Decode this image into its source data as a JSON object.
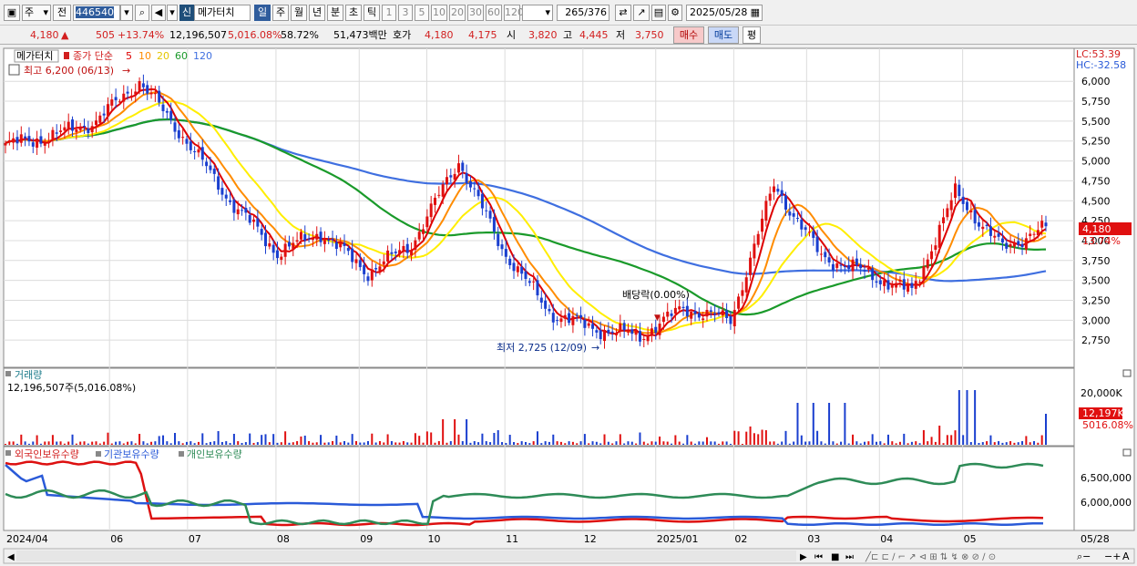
{
  "toolbar": {
    "market": "주",
    "prev_label": "전",
    "code": "446540",
    "new_badge": "신",
    "stock_name": "메가터치",
    "periods": [
      "일",
      "주",
      "월",
      "년",
      "분",
      "초",
      "틱"
    ],
    "intervals": [
      "1",
      "3",
      "5",
      "10",
      "20",
      "30",
      "60",
      "120"
    ],
    "count": "265",
    "total": "/376",
    "date": "2025/05/28"
  },
  "quote": {
    "price": "4,180",
    "change": "505",
    "change_pct": "+13.74%",
    "volume": "12,196,507",
    "volume_ratio": "5,016.08%",
    "turnover_pct": "58.72%",
    "amount": "51,473백만",
    "bid_label": "호가",
    "bid": "4,180",
    "ask": "4,175",
    "open_label": "시",
    "open": "3,820",
    "high_label": "고",
    "high": "4,445",
    "low_label": "저",
    "low": "3,750",
    "buy_label": "매수",
    "sell_label": "매도",
    "eval_label": "평"
  },
  "colors": {
    "candle_up": "#e01010",
    "candle_down": "#1a3fcf",
    "ma5": "#dd0000",
    "ma10": "#ff8c00",
    "ma20": "#ffee00",
    "ma60": "#1a9a2a",
    "ma120": "#3f6fe0",
    "foreign": "#dd1010",
    "institution": "#2a5ad8",
    "individual": "#2e8b57",
    "grid": "#dcdcdc"
  },
  "price_panel": {
    "stock_name": "메가터치",
    "ma_label": "종가 단순",
    "ma_periods": [
      "5",
      "10",
      "20",
      "60",
      "120"
    ],
    "lc_label": "LC:53.39",
    "hc_label": "HC:-32.58",
    "high_annotation": "최고 6,200 (06/13)",
    "low_annotation": "최저 2,725 (12/09)",
    "dividend_annotation": "배당락(0.00%)",
    "current_price_tag": "4,180",
    "current_pct_tag": "13.74%"
  },
  "volume_panel": {
    "title": "거래량",
    "summary": "12,196,507주(5,016.08%)",
    "axis_label": "20,000K",
    "current_tag": "12,197K",
    "current_pct_tag": "5016.08%"
  },
  "holding_panel": {
    "legend": [
      "외국인보유수량",
      "기관보유수량",
      "개인보유수량"
    ],
    "axis_labels": [
      "6,500,000",
      "6,000,000"
    ]
  },
  "x_axis_labels": [
    "2024/04",
    "06",
    "07",
    "08",
    "09",
    "10",
    "11",
    "12",
    "2025/01",
    "02",
    "03",
    "04",
    "05",
    "05/28"
  ],
  "chart_data": {
    "type": "line",
    "title": "메가터치",
    "price_axis": {
      "ticks": [
        6000,
        5750,
        5500,
        5250,
        5000,
        4750,
        4500,
        4250,
        4000,
        3750,
        3500,
        3250,
        3000,
        2750
      ],
      "range": [
        2500,
        6300
      ]
    },
    "close_series": {
      "name": "종가",
      "keypoints": [
        {
          "label": "2024/04",
          "value": 5200
        },
        {
          "label": "05",
          "value": 5300
        },
        {
          "label": "06",
          "value": 5500
        },
        {
          "label": "06/13",
          "value": 6000
        },
        {
          "label": "07",
          "value": 5250
        },
        {
          "label": "08",
          "value": 4500
        },
        {
          "label": "08 low",
          "value": 3850
        },
        {
          "label": "09",
          "value": 4100
        },
        {
          "label": "09 low",
          "value": 3600
        },
        {
          "label": "10",
          "value": 3950
        },
        {
          "label": "10 high",
          "value": 5000
        },
        {
          "label": "11",
          "value": 3900
        },
        {
          "label": "11 low",
          "value": 3100
        },
        {
          "label": "12",
          "value": 2900
        },
        {
          "label": "12/09",
          "value": 2800
        },
        {
          "label": "2025/01",
          "value": 3150
        },
        {
          "label": "02",
          "value": 3000
        },
        {
          "label": "03 high",
          "value": 4700
        },
        {
          "label": "03",
          "value": 3800
        },
        {
          "label": "04",
          "value": 3600
        },
        {
          "label": "04 low",
          "value": 3350
        },
        {
          "label": "05 high",
          "value": 4600
        },
        {
          "label": "05",
          "value": 3900
        },
        {
          "label": "05/28",
          "value": 4180
        }
      ]
    },
    "annotations": [
      {
        "text": "최고 6,200 (06/13)",
        "value": 6200
      },
      {
        "text": "최저 2,725 (12/09)",
        "value": 2725
      }
    ],
    "volume_axis": {
      "ticks": [
        20000
      ],
      "unit": "K"
    },
    "holding_axis": {
      "ticks": [
        6500000,
        6000000
      ]
    },
    "legend_placement": "top-left",
    "grid": true
  }
}
